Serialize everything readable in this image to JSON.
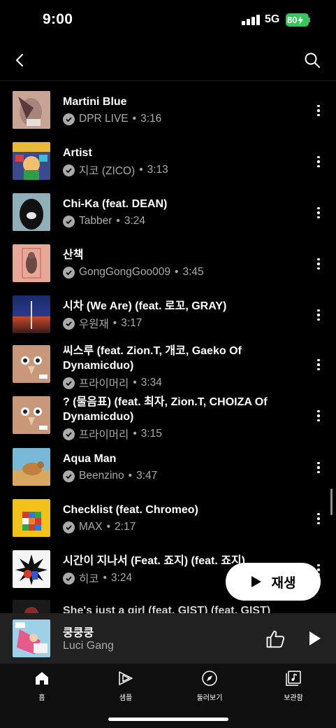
{
  "status": {
    "time": "9:00",
    "network": "5G",
    "battery": "80"
  },
  "header": {
    "back_icon": "chevron-left-icon",
    "search_icon": "search-icon"
  },
  "tracks": [
    {
      "title": "Martini Blue",
      "artist": "DPR LIVE",
      "duration": "3:16"
    },
    {
      "title": "Artist",
      "artist": "지코 (ZICO)",
      "duration": "3:13"
    },
    {
      "title": "Chi-Ka (feat. DEAN)",
      "artist": "Tabber",
      "duration": "3:24"
    },
    {
      "title": "산책",
      "artist": "GongGongGoo009",
      "duration": "3:45"
    },
    {
      "title": "시차 (We Are) (feat. 로꼬, GRAY)",
      "artist": "우원재",
      "duration": "3:17"
    },
    {
      "title": "씨스루 (feat. Zion.T, 개코, Gaeko Of Dynamicduo)",
      "artist": "프라이머리",
      "duration": "3:34"
    },
    {
      "title": "? (물음표) (feat. 최자, Zion.T, CHOIZA Of Dynamicduo)",
      "artist": "프라이머리",
      "duration": "3:15"
    },
    {
      "title": "Aqua Man",
      "artist": "Beenzino",
      "duration": "3:47"
    },
    {
      "title": "Checklist (feat. Chromeo)",
      "artist": "MAX",
      "duration": "2:17"
    },
    {
      "title": "시간이 지나서 (Feat. 죠지) (feat. 죠지)",
      "artist": "히코",
      "duration": "3:24"
    },
    {
      "title": "She's just a girl (feat. GIST) (feat. GIST)",
      "artist": "",
      "duration": ""
    }
  ],
  "fab": {
    "label": "재생"
  },
  "mini_player": {
    "title": "쿵쿵쿵",
    "artist": "Luci Gang"
  },
  "nav": [
    {
      "label": "홈",
      "icon": "home-icon"
    },
    {
      "label": "샘플",
      "icon": "samples-icon"
    },
    {
      "label": "둘러보기",
      "icon": "explore-icon"
    },
    {
      "label": "보관함",
      "icon": "library-icon"
    }
  ],
  "colors": {
    "background": "#000000",
    "mini_player": "#212121",
    "battery": "#34c759",
    "subtext": "#aaaaaa"
  }
}
